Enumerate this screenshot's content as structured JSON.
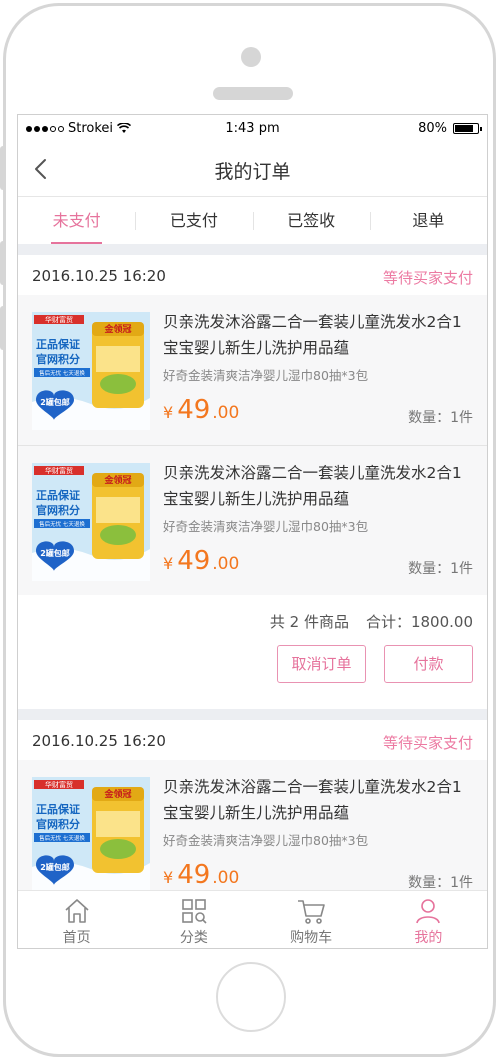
{
  "status_bar": {
    "carrier": "Strokei",
    "time": "1:43 pm",
    "battery": "80%",
    "battery_level": 0.8
  },
  "nav": {
    "title": "我的订单"
  },
  "tabs": [
    {
      "label": "未支付",
      "active": true
    },
    {
      "label": "已支付",
      "active": false
    },
    {
      "label": "已签收",
      "active": false
    },
    {
      "label": "退单",
      "active": false
    }
  ],
  "orders": [
    {
      "date": "2016.10.25 16:20",
      "status": "等待买家支付",
      "items": [
        {
          "title": "贝亲洗发沐浴露二合一套装儿童洗发水2合1宝宝婴儿新生儿洗护用品蕴",
          "spec": "好奇金装清爽洁净婴儿湿巾80抽*3包",
          "currency": "¥",
          "price_int": "49",
          "price_dec": ".00",
          "qty": "数量：1件"
        },
        {
          "title": "贝亲洗发沐浴露二合一套装儿童洗发水2合1宝宝婴儿新生儿洗护用品蕴",
          "spec": "好奇金装清爽洁净婴儿湿巾80抽*3包",
          "currency": "¥",
          "price_int": "49",
          "price_dec": ".00",
          "qty": "数量：1件"
        }
      ],
      "summary_count": "共 2 件商品",
      "summary_total": "合计：1800.00",
      "cancel_label": "取消订单",
      "pay_label": "付款"
    },
    {
      "date": "2016.10.25 16:20",
      "status": "等待买家支付",
      "items": [
        {
          "title": "贝亲洗发沐浴露二合一套装儿童洗发水2合1宝宝婴儿新生儿洗护用品蕴",
          "spec": "好奇金装清爽洁净婴儿湿巾80抽*3包",
          "currency": "¥",
          "price_int": "49",
          "price_dec": ".00",
          "qty": "数量：1件"
        }
      ]
    }
  ],
  "product_image": {
    "badge_top": "华财富贸",
    "brand": "金领冠",
    "line1": "正品保证",
    "line2": "官网积分",
    "line3": "售后无忧 七天退换",
    "promo": "2罐包邮"
  },
  "bottom_nav": [
    {
      "label": "首页",
      "icon": "home-icon",
      "active": false
    },
    {
      "label": "分类",
      "icon": "category-icon",
      "active": false
    },
    {
      "label": "购物车",
      "icon": "cart-icon",
      "active": false
    },
    {
      "label": "我的",
      "icon": "user-icon",
      "active": true
    }
  ],
  "colors": {
    "accent": "#e6739c",
    "price": "#f3771f",
    "gap": "#eceef2"
  }
}
